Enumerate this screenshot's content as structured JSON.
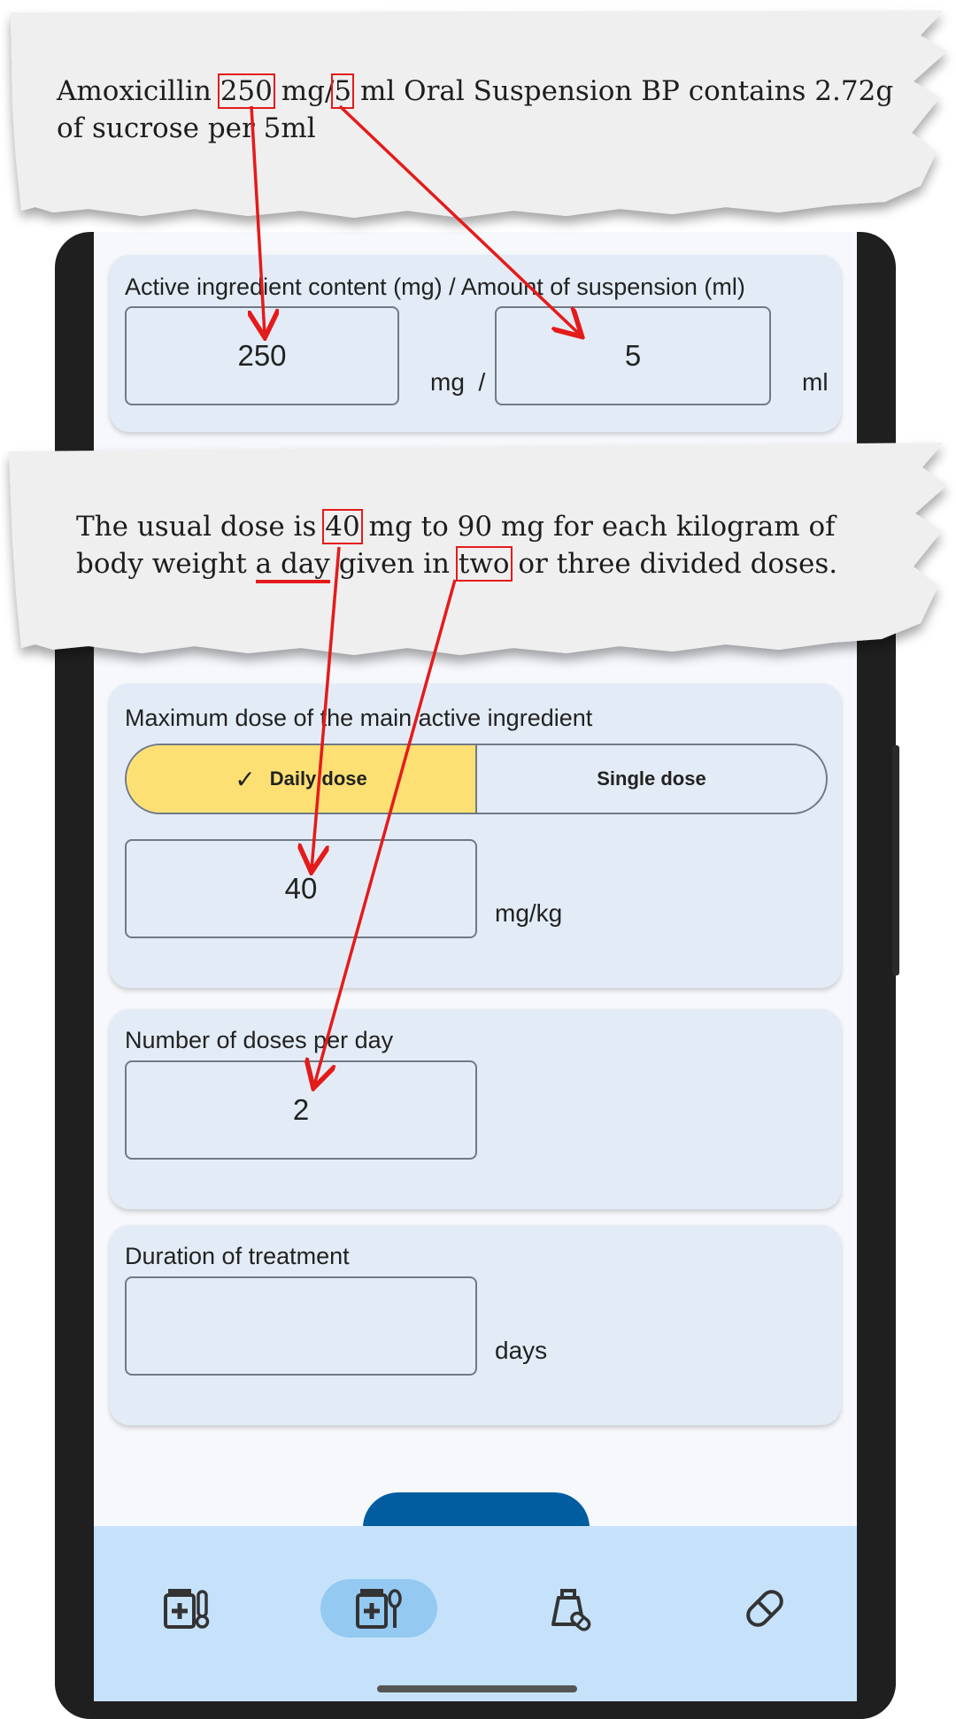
{
  "note1": {
    "line1_prefix": "Amoxicillin",
    "line1_strength": "250",
    "line1_mid": "mg/",
    "line1_volume": "5",
    "line1_suffix": "ml Oral Suspension BP contains 2.72g",
    "line2": "of sucrose per 5ml"
  },
  "note2": {
    "line1_prefix": "The usual dose is",
    "line1_dose": "40",
    "line1_suffix": "mg to 90 mg for each kilogram of",
    "line2_prefix": "body weight",
    "line2_underlined": "a day",
    "line2_mid": "given in",
    "line2_count": "two",
    "line2_suffix": "or three divided doses."
  },
  "content_card": {
    "label": "Active ingredient content (mg) / Amount of suspension (ml)",
    "mg_value": "250",
    "mg_unit": "mg  /",
    "ml_value": "5",
    "ml_unit": "ml"
  },
  "max_dose_card": {
    "label": "Maximum dose of the main active ingredient",
    "toggle_daily": "Daily dose",
    "toggle_single": "Single dose",
    "toggle_selected": "Daily dose",
    "value": "40",
    "unit": "mg/kg"
  },
  "doses_card": {
    "label": "Number of doses per day",
    "value": "2"
  },
  "duration_card": {
    "label": "Duration of treatment",
    "value": "",
    "unit": "days"
  },
  "bottom_nav": {
    "items": [
      {
        "icon": "medicine-thermometer-icon",
        "active": false
      },
      {
        "icon": "medicine-spoon-icon",
        "active": true
      },
      {
        "icon": "bag-pill-icon",
        "active": false
      },
      {
        "icon": "pill-icon",
        "active": false
      }
    ]
  },
  "colors": {
    "accent_red": "#e41b1b",
    "toggle_selected": "#fde074",
    "card_bg": "#e3ecf6",
    "fab": "#015da0",
    "nav_bar": "#c6e2fb",
    "nav_active": "#94c9f2"
  }
}
